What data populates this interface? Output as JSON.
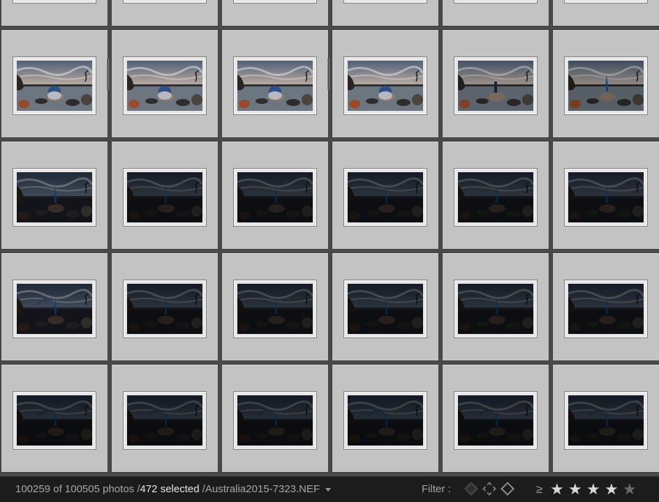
{
  "grid": {
    "cells": [
      {
        "t": "t0",
        "sel": false
      },
      {
        "t": "t0",
        "sel": false
      },
      {
        "t": "t0",
        "sel": false
      },
      {
        "t": "t0",
        "sel": false
      },
      {
        "t": "t0",
        "sel": false
      },
      {
        "t": "t0",
        "sel": false
      },
      {
        "t": "d1",
        "sel": true,
        "stack": true
      },
      {
        "t": "d1",
        "sel": true
      },
      {
        "t": "d1",
        "sel": true,
        "stack": true
      },
      {
        "t": "d1",
        "sel": true
      },
      {
        "t": "d2",
        "sel": true
      },
      {
        "t": "d3",
        "sel": true
      },
      {
        "t": "b1",
        "sel": true
      },
      {
        "t": "b2",
        "sel": true
      },
      {
        "t": "b2",
        "sel": true
      },
      {
        "t": "b2",
        "sel": true
      },
      {
        "t": "b2",
        "sel": true
      },
      {
        "t": "b2",
        "sel": true
      },
      {
        "t": "b3",
        "sel": true
      },
      {
        "t": "b4",
        "sel": true
      },
      {
        "t": "b4",
        "sel": true
      },
      {
        "t": "b4",
        "sel": true
      },
      {
        "t": "b4",
        "sel": true
      },
      {
        "t": "b4",
        "sel": true
      },
      {
        "t": "b5",
        "sel": true
      },
      {
        "t": "b5",
        "sel": true
      },
      {
        "t": "b5",
        "sel": true
      },
      {
        "t": "b5",
        "sel": true
      },
      {
        "t": "b5",
        "sel": true
      },
      {
        "t": "b5",
        "sel": true
      }
    ]
  },
  "status": {
    "count": "100259 of 100505 photos /",
    "selected": "472 selected",
    "filename": "/Australia2015-7323.NEF"
  },
  "filter": {
    "label": "Filter :",
    "rating_op": "≥",
    "star_glyph": "★",
    "min_rating": 4,
    "max_rating": 5,
    "colors": {
      "star_on": "#d8d8d8",
      "star_off": "#6a6a6a",
      "flag_pick": "#4a4a4a",
      "flag_unflagged": "#777777",
      "flag_reject": "#909090"
    }
  }
}
